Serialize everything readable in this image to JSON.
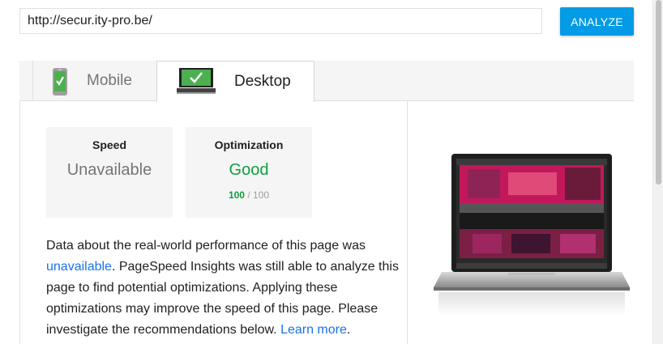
{
  "search": {
    "url_value": "http://secur.ity-pro.be/",
    "analyze_label": "ANALYZE"
  },
  "tabs": [
    {
      "label": "Mobile",
      "icon": "mobile-phone-check-icon",
      "selected": false
    },
    {
      "label": "Desktop",
      "icon": "desktop-laptop-check-icon",
      "selected": true
    }
  ],
  "cards": {
    "speed": {
      "title": "Speed",
      "value": "Unavailable"
    },
    "optimization": {
      "title": "Optimization",
      "value": "Good",
      "score": "100",
      "score_max": "/ 100"
    }
  },
  "summary": {
    "part1": "Data about the real-world performance of this page was ",
    "link1": "unavailable",
    "part2": ". PageSpeed Insights was still able to analyze this page to find potential optimizations. Applying these optimizations may improve the speed of this page. Please investigate the recommendations below. ",
    "link2": "Learn more",
    "part3": "."
  },
  "colors": {
    "accent": "#039be5",
    "good": "#0d9f3e",
    "link": "#1a73e8"
  }
}
